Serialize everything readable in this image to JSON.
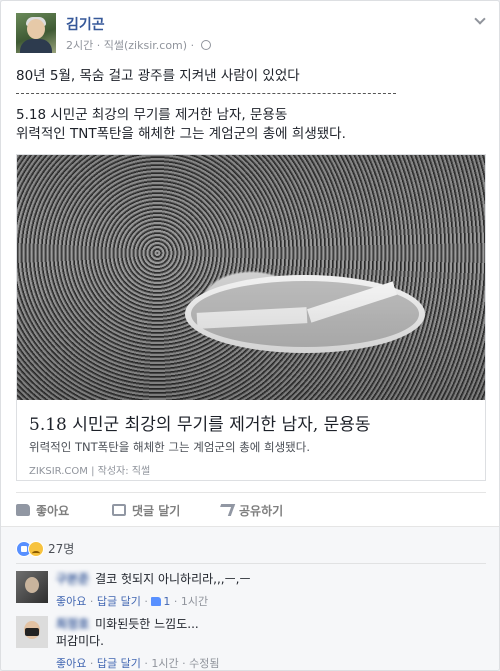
{
  "post": {
    "author": "김기곤",
    "time": "2시간",
    "via": "직썰(ziksir.com)",
    "lines": [
      "80년 5월, 목숨 걸고 광주를 지켜낸 사람이 있었다",
      "5.18 시민군 최강의 무기를 제거한 남자, 문용동",
      "위력적인 TNT폭탄을 해체한 그는 계엄군의 총에 희생됐다."
    ],
    "link": {
      "title": "5.18 시민군 최강의 무기를 제거한 남자, 문용동",
      "description": "위력적인 TNT폭탄을 해체한 그는 계엄군의 총에 희생됐다.",
      "source": "ZIKSIR.COM",
      "author": "작성자: 직썰"
    }
  },
  "actions": {
    "like": "좋아요",
    "comment": "댓글 달기",
    "share": "공유하기"
  },
  "reactions": {
    "count": "27명",
    "types": [
      "like-icon",
      "sad-icon"
    ]
  },
  "comments": [
    {
      "name": "구본준",
      "text": "결코 헛되지 아니하리라,,,ㅡ,ㅡ",
      "like": "좋아요",
      "reply": "답글 달기",
      "likes": "1",
      "time": "1시간",
      "edited": ""
    },
    {
      "name": "최정호",
      "text": "미화된듯한 느낌도...",
      "text2": "퍼감미다.",
      "like": "좋아요",
      "reply": "답글 달기",
      "likes": "",
      "time": "1시간",
      "edited": "수정됨"
    }
  ],
  "colors": {
    "link_blue": "#365899",
    "meta_gray": "#90949c",
    "like_blue": "#5890ff"
  }
}
